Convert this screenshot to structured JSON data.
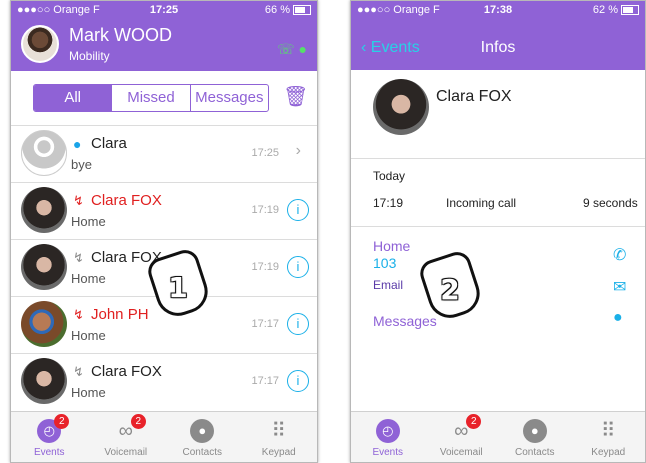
{
  "phone1": {
    "status": {
      "carrier": "●●●○○ Orange F",
      "time": "17:25",
      "battery": "66 %"
    },
    "header": {
      "name": "Mark WOOD",
      "subtitle": "Mobility"
    },
    "segments": [
      "All",
      "Missed",
      "Messages"
    ],
    "rows": [
      {
        "name": "Clara",
        "sub": "bye",
        "time": "17:25",
        "type": "message"
      },
      {
        "name": "Clara FOX",
        "sub": "Home",
        "time": "17:19",
        "type": "missed"
      },
      {
        "name": "Clara FOX",
        "sub": "Home",
        "time": "17:19",
        "type": "call"
      },
      {
        "name": "John PH",
        "sub": "Home",
        "time": "17:17",
        "type": "missed"
      },
      {
        "name": "Clara FOX",
        "sub": "Home",
        "time": "17:17",
        "type": "call"
      }
    ],
    "step": "1",
    "tabs": [
      {
        "label": "Events",
        "badge": "2"
      },
      {
        "label": "Voicemail",
        "badge": "2"
      },
      {
        "label": "Contacts"
      },
      {
        "label": "Keypad"
      }
    ]
  },
  "phone2": {
    "status": {
      "carrier": "●●●○○ Orange F",
      "time": "17:38",
      "battery": "62 %"
    },
    "header": {
      "back": "Events",
      "title": "Infos"
    },
    "contact": {
      "name": "Clara FOX"
    },
    "today_label": "Today",
    "call": {
      "time": "17:19",
      "type": "Incoming call",
      "duration": "9 seconds"
    },
    "home_label": "Home",
    "home_number": "103",
    "email_label": "Email",
    "messages_label": "Messages",
    "step": "2",
    "tabs": [
      {
        "label": "Events"
      },
      {
        "label": "Voicemail",
        "badge": "2"
      },
      {
        "label": "Contacts"
      },
      {
        "label": "Keypad"
      }
    ]
  },
  "colors": {
    "accent": "#8f62d6",
    "missed": "#e02020",
    "info": "#1ab0e8"
  }
}
